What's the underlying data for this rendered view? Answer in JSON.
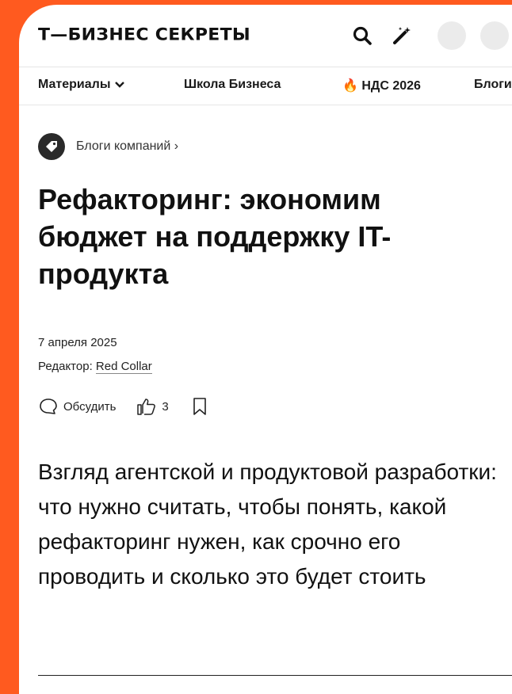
{
  "header": {
    "logo": "Т—БИЗНЕС СЕКРЕТЫ",
    "icons": [
      "search-icon",
      "magic-wand-icon"
    ]
  },
  "nav": {
    "items": [
      {
        "label": "Материалы",
        "icon": "chevron-down-icon"
      },
      {
        "label": "Школа Бизнеса"
      },
      {
        "label": "🔥 НДС 2026"
      },
      {
        "label": "Блоги"
      }
    ]
  },
  "breadcrumb": {
    "label": "Блоги компаний ›",
    "icon": "tag-icon"
  },
  "article": {
    "title": "Рефакторинг: экономим бюджет на поддержку IT-продукта",
    "date": "7 апреля 2025",
    "editor_prefix": "Редактор: ",
    "editor_name": "Red Collar",
    "lead": "Взгляд агентской и продуктовой разработки: что нужно считать, чтобы понять, какой рефакторинг нужен, как срочно его проводить и сколько это будет стоить"
  },
  "actions": {
    "discuss_label": "Обсудить",
    "likes_count": "3"
  },
  "colors": {
    "accent_background": "#ff5a1f"
  }
}
